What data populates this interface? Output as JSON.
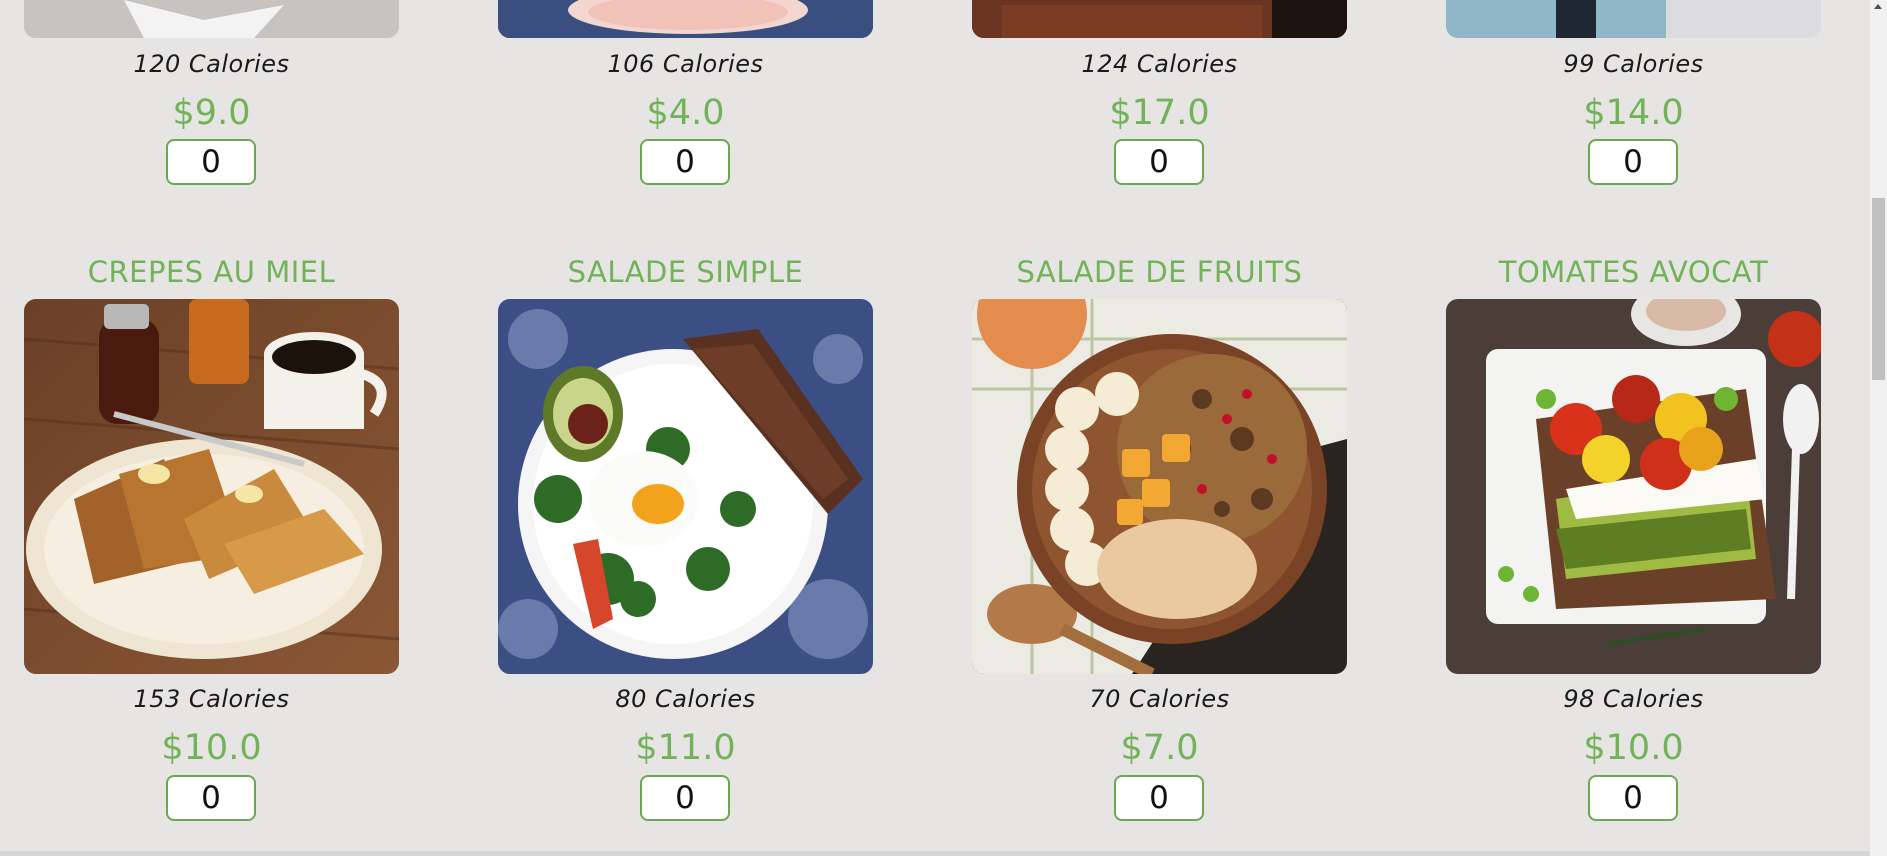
{
  "top_row": [
    {
      "calories": "120 Calories",
      "price": "$9.0",
      "quantity": "0"
    },
    {
      "calories": "106 Calories",
      "price": "$4.0",
      "quantity": "0"
    },
    {
      "calories": "124 Calories",
      "price": "$17.0",
      "quantity": "0"
    },
    {
      "calories": "99 Calories",
      "price": "$14.0",
      "quantity": "0"
    }
  ],
  "bottom_row": [
    {
      "title": "CREPES AU MIEL",
      "calories": "153 Calories",
      "price": "$10.0",
      "quantity": "0",
      "image": "french-toast-photo"
    },
    {
      "title": "SALADE SIMPLE",
      "calories": "80 Calories",
      "price": "$11.0",
      "quantity": "0",
      "image": "egg-salad-photo"
    },
    {
      "title": "SALADE DE FRUITS",
      "calories": "70 Calories",
      "price": "$7.0",
      "quantity": "0",
      "image": "fruit-bowl-photo"
    },
    {
      "title": "TOMATES AVOCAT",
      "calories": "98 Calories",
      "price": "$10.0",
      "quantity": "0",
      "image": "avocado-toast-photo"
    }
  ],
  "colors": {
    "accent": "#72b35a",
    "background": "#e7e4e4"
  }
}
